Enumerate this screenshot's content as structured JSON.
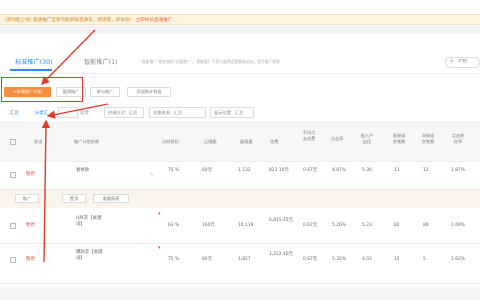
{
  "notice": {
    "text": "[新功能上线] 直通推广全新功能新鲜直通车，新场景，新体验！",
    "link": "立即体验直通推广"
  },
  "tabs": [
    {
      "label": "标准推广(30)",
      "active": true
    },
    {
      "label": "智能推广(1)",
      "active": false
    }
  ],
  "tab_desc": "\"智能推广\"即在我的\"托管推广\"。智能推广下您可选择设置最高出价，提升推广效率",
  "search": {
    "placeholder": "计划"
  },
  "toolbar": {
    "new_plan": "+新建推广计划",
    "pause": "暂停推广",
    "note": "参与推广",
    "add_plan": "添加到计划组"
  },
  "filters": {
    "summary": "汇总",
    "split": "分类汇",
    "settings": "新建",
    "select1": "",
    "select2": "终端方式：汇总",
    "select3": "流量来源：汇总",
    "select4": "展示位置：汇总"
  },
  "columns": [
    "状态",
    "推广计划名称",
    "分时折扣",
    "日限额",
    "展现量",
    "花费",
    "平均点击花费",
    "点击率",
    "投入产出比",
    "直接成交笔数",
    "间接成交笔数",
    "点击转化率"
  ],
  "rows": [
    {
      "status": "暂停",
      "name": "春季款",
      "discount": "75 %",
      "budget": "60元",
      "impressions": "1,132",
      "cost": "821.10元",
      "cpc": "0.67元",
      "ctr": "4.87%",
      "roi": "5.36",
      "direct": "11",
      "indirect": "12",
      "cvr": "1.87%"
    },
    {
      "status": "暂停",
      "name": "H风衣【关键词】",
      "discount": "63 %",
      "budget": "160元",
      "impressions": "10,119",
      "cost": "6,815.45元",
      "cpc": "0.67元",
      "ctr": "5.26%",
      "roi": "5.23",
      "direct": "82",
      "indirect": "89",
      "cvr": "1.69%"
    },
    {
      "status": "暂停",
      "name": "爆款衣【关键词】",
      "discount": "75 %",
      "budget": "80元",
      "impressions": "1,827",
      "cost": "1,222.40元",
      "cpc": "0.67元",
      "ctr": "5.32%",
      "roi": "4.02",
      "direct": "15",
      "indirect": "5",
      "cvr": "1.62%"
    }
  ],
  "row_actions": [
    "推广",
    "置顶",
    "查看报表"
  ]
}
